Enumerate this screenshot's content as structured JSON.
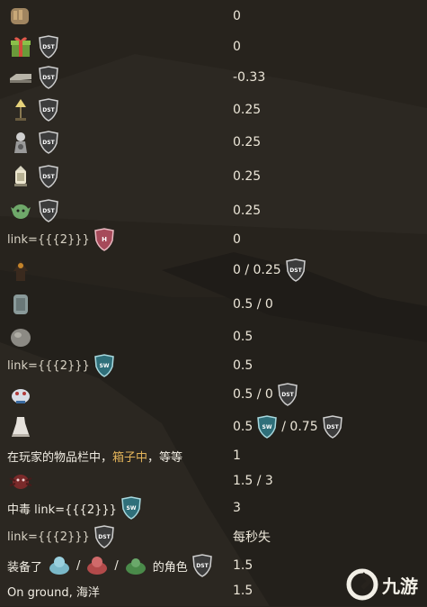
{
  "rows": [
    {
      "value": "0"
    },
    {
      "value": "0"
    },
    {
      "value": "-0.33"
    },
    {
      "value": "0.25"
    },
    {
      "value": "0.25"
    },
    {
      "value": "0.25"
    },
    {
      "value": "0.25"
    },
    {
      "label": "link={{{2}}}",
      "value": "0"
    },
    {
      "value_a": "0 / 0.25"
    },
    {
      "value": "0.5 / 0"
    },
    {
      "value": "0.5"
    },
    {
      "label": "link={{{2}}}",
      "value": "0.5"
    },
    {
      "value_a": "0.5 / 0"
    },
    {
      "value_a": "0.5",
      "value_b": "/ 0.75"
    },
    {
      "label_pre": "在玩家的物品栏中，",
      "label_hl": "箱子中",
      "label_post": "，等等",
      "value": "1"
    },
    {
      "value": "1.5 / 3"
    },
    {
      "label": "中毒 link={{{2}}}",
      "value": "3"
    },
    {
      "label": "link={{{2}}}",
      "value": "每秒失"
    },
    {
      "label_pre": "装备了",
      "label_sep1": "/",
      "label_sep2": "/",
      "label_post": "的角色",
      "value": "1.5"
    },
    {
      "label": "On ground, 海洋",
      "value": "1.5"
    }
  ],
  "badges": {
    "dst": "DST",
    "sw": "SW",
    "h": "H"
  },
  "watermark": {
    "text": "九游"
  },
  "colors": {
    "shield": "#3c3c3c",
    "sw": "#2f6f7a",
    "h": "#a64a5a"
  }
}
